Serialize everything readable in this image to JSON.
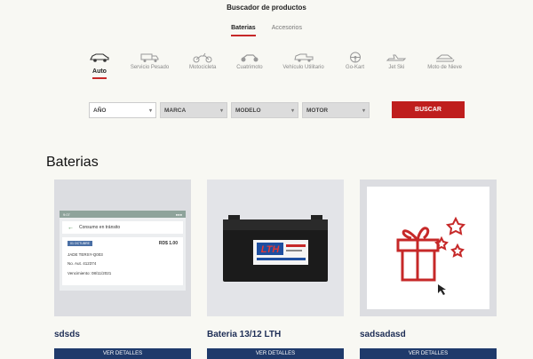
{
  "page": {
    "title": "Buscador de productos"
  },
  "tabs": [
    {
      "label": "Baterias",
      "active": true
    },
    {
      "label": "Accesorios",
      "active": false
    }
  ],
  "vehicles": [
    {
      "label": "Auto",
      "icon": "car-icon",
      "active": true
    },
    {
      "label": "Servicio Pesado",
      "icon": "truck-icon",
      "active": false
    },
    {
      "label": "Motocicleta",
      "icon": "motorcycle-icon",
      "active": false
    },
    {
      "label": "Cuatrimoto",
      "icon": "atv-icon",
      "active": false
    },
    {
      "label": "Vehículo Utilitario",
      "icon": "utility-vehicle-icon",
      "active": false
    },
    {
      "label": "Go-Kart",
      "icon": "steering-wheel-icon",
      "active": false
    },
    {
      "label": "Jet Ski",
      "icon": "jetski-icon",
      "active": false
    },
    {
      "label": "Moto de Nieve",
      "icon": "snowmobile-icon",
      "active": false
    }
  ],
  "filters": {
    "year": "AÑO",
    "brand": "MARCA",
    "model": "MODELO",
    "engine": "MOTOR",
    "search_label": "BUSCAR"
  },
  "section": {
    "title": "Baterias"
  },
  "products": [
    {
      "name": "sdsds",
      "button": "VER DETALLES",
      "screenshot": {
        "time": "9:07",
        "header": "Consumo en tránsito",
        "chip": "01 OCTUBRE",
        "amount": "RD$ 1.00",
        "line1": "JADE TERSY-Q003",
        "line2": "No. Aut.   412374",
        "line3": "Vencimiento:   08/11/2021"
      }
    },
    {
      "name": "Bateria 13/12 LTH",
      "button": "VER DETALLES",
      "battery_logo": "LTH"
    },
    {
      "name": "sadsadasd",
      "button": "VER DETALLES"
    }
  ],
  "colors": {
    "accent": "#c62828",
    "navy": "#1f3a6b",
    "bg": "#f8f8f3"
  }
}
